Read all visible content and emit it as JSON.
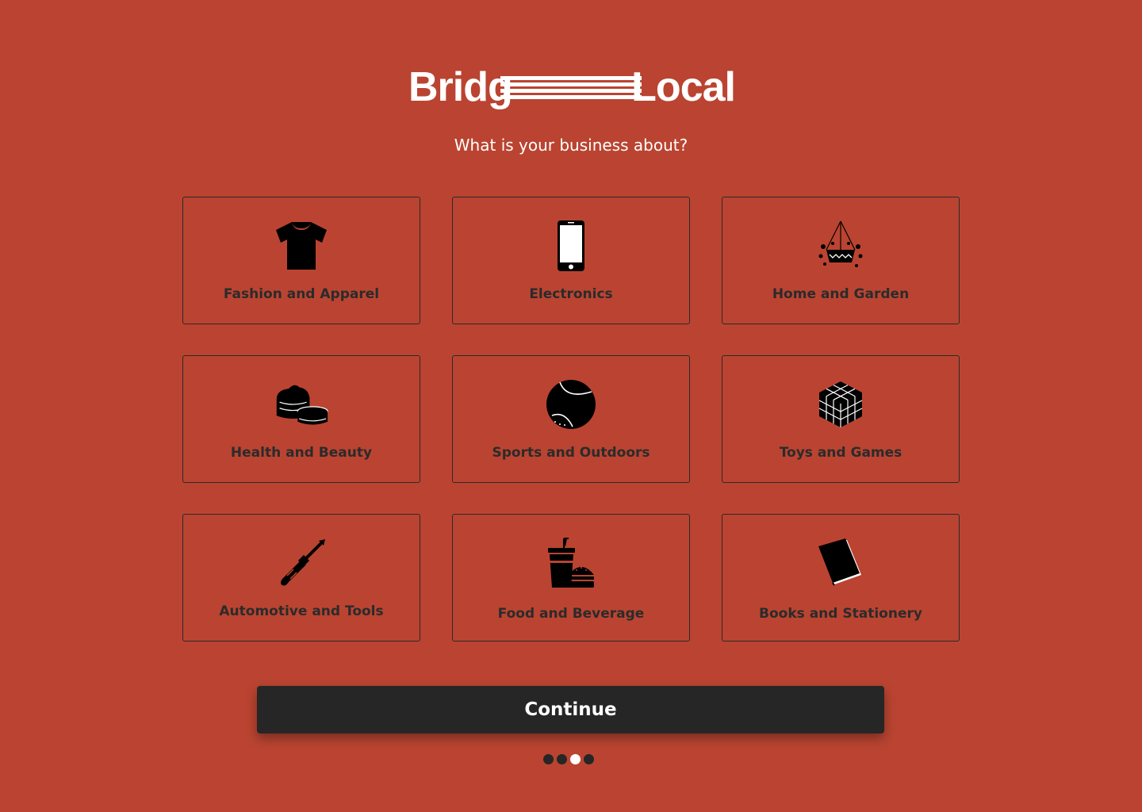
{
  "logo": {
    "left_text": "Bridg",
    "right_text": "Local",
    "color": "#FFFFFF"
  },
  "subtitle": "What is your business about?",
  "categories": [
    {
      "label": "Fashion and Apparel",
      "icon": "tshirt-icon"
    },
    {
      "label": "Electronics",
      "icon": "smartphone-icon"
    },
    {
      "label": "Home and Garden",
      "icon": "hanging-planter-icon"
    },
    {
      "label": "Health and Beauty",
      "icon": "cream-jars-icon"
    },
    {
      "label": "Sports and Outdoors",
      "icon": "tennis-ball-icon"
    },
    {
      "label": "Toys and Games",
      "icon": "rubiks-cube-icon"
    },
    {
      "label": "Automotive and Tools",
      "icon": "screwdriver-icon"
    },
    {
      "label": "Food and Beverage",
      "icon": "drink-burger-icon"
    },
    {
      "label": "Books and Stationery",
      "icon": "book-icon"
    }
  ],
  "continue_label": "Continue",
  "progress": {
    "total_steps": 4,
    "current_step": 3
  },
  "colors": {
    "background": "#BA4431",
    "card_border": "#2A2A2A",
    "label_text": "#2B2B2B",
    "button_bg": "#262626",
    "button_text": "#FFFFFF"
  }
}
